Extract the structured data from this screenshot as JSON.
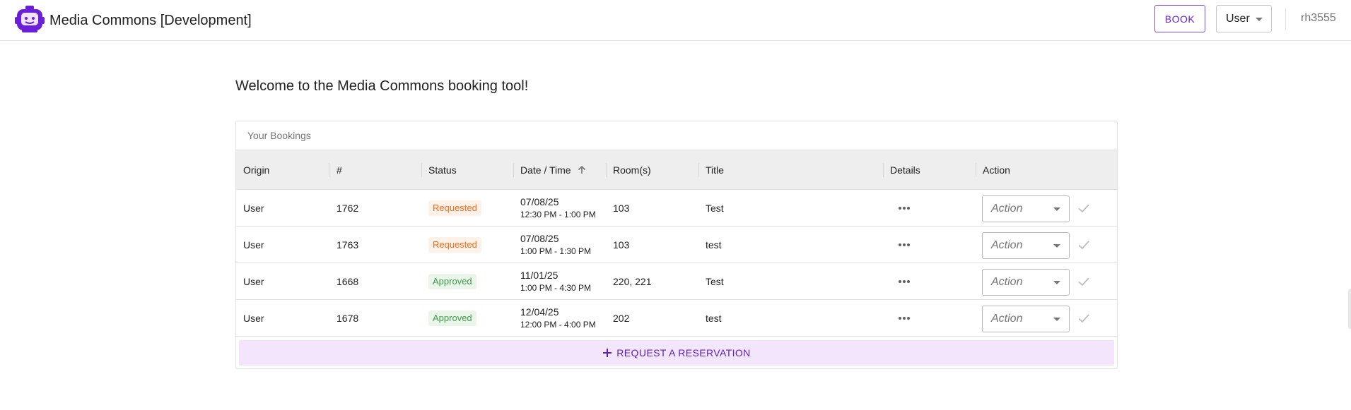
{
  "header": {
    "title": "Media Commons [Development]",
    "book_label": "BOOK",
    "role": "User",
    "username": "rh3555",
    "logo_icon": "robot-logo-icon"
  },
  "colors": {
    "accent": "#6a1fd8",
    "requested_text": "#f26b1d",
    "requested_bg": "#fdf1e8",
    "approved_text": "#3e9b47",
    "approved_bg": "#eaf6ea",
    "request_bg": "#f3e5fc"
  },
  "main": {
    "welcome": "Welcome to the Media Commons booking tool!",
    "card_title": "Your Bookings",
    "columns": {
      "origin": "Origin",
      "number": "#",
      "status": "Status",
      "datetime": "Date / Time",
      "rooms": "Room(s)",
      "title": "Title",
      "details": "Details",
      "action": "Action"
    },
    "sort_icon": "arrow-up-icon",
    "rows": [
      {
        "origin": "User",
        "number": "1762",
        "status": "Requested",
        "date": "07/08/25",
        "time": "12:30 PM - 1:00 PM",
        "rooms": "103",
        "title": "Test",
        "action_placeholder": "Action"
      },
      {
        "origin": "User",
        "number": "1763",
        "status": "Requested",
        "date": "07/08/25",
        "time": "1:00 PM - 1:30 PM",
        "rooms": "103",
        "title": "test",
        "action_placeholder": "Action"
      },
      {
        "origin": "User",
        "number": "1668",
        "status": "Approved",
        "date": "11/01/25",
        "time": "1:00 PM - 4:30 PM",
        "rooms": "220, 221",
        "title": "Test",
        "action_placeholder": "Action"
      },
      {
        "origin": "User",
        "number": "1678",
        "status": "Approved",
        "date": "12/04/25",
        "time": "12:00 PM - 4:00 PM",
        "rooms": "202",
        "title": "test",
        "action_placeholder": "Action"
      }
    ],
    "request_label": "REQUEST A RESERVATION"
  }
}
